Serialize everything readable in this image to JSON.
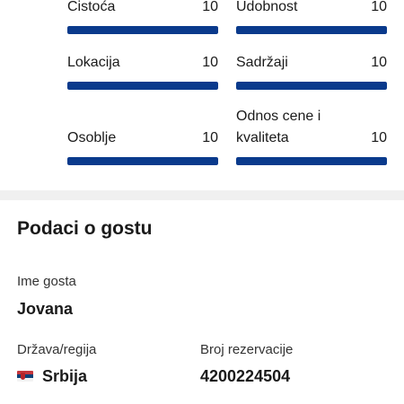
{
  "scores": [
    {
      "label": "Čistoća",
      "value": "10",
      "fill": 1.0
    },
    {
      "label": "Udobnost",
      "value": "10",
      "fill": 1.0
    },
    {
      "label": "Lokacija",
      "value": "10",
      "fill": 1.0
    },
    {
      "label": "Sadržaji",
      "value": "10",
      "fill": 1.0
    },
    {
      "label": "Osoblje",
      "value": "10",
      "fill": 1.0
    },
    {
      "label_line1": "Odnos cene i",
      "label_line2": "kvaliteta",
      "value": "10",
      "fill": 1.0
    }
  ],
  "colors": {
    "bar_fill": "#0a3a8c",
    "bar_track": "#e6e6e6",
    "divider": "#f0f0f0"
  },
  "guest": {
    "title": "Podaci o gostu",
    "name_label": "Ime gosta",
    "name_value": "Jovana",
    "country_label": "Država/regija",
    "country_flag": "serbia-flag-icon",
    "country_value": "Srbija",
    "booking_label": "Broj rezervacije",
    "booking_value": "4200224504"
  }
}
